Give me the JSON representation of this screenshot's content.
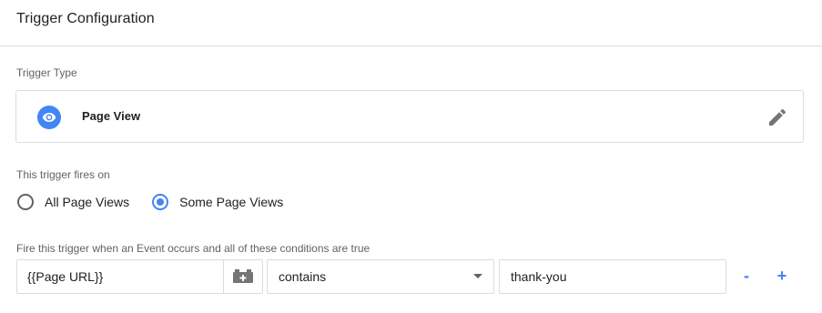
{
  "header": {
    "title": "Trigger Configuration"
  },
  "trigger_type": {
    "label": "Trigger Type",
    "name": "Page View",
    "icon": "eye-icon",
    "edit_icon": "pencil-icon"
  },
  "fires_on": {
    "label": "This trigger fires on",
    "options": [
      {
        "label": "All Page Views",
        "selected": false
      },
      {
        "label": "Some Page Views",
        "selected": true
      }
    ]
  },
  "conditions": {
    "label": "Fire this trigger when an Event occurs and all of these conditions are true",
    "rows": [
      {
        "variable": "{{Page URL}}",
        "operator": "contains",
        "value": "thank-you"
      }
    ],
    "remove_label": "-",
    "add_label": "+"
  },
  "colors": {
    "accent": "#4285f4",
    "border": "#dadce0",
    "secondary_text": "#5f6368"
  }
}
